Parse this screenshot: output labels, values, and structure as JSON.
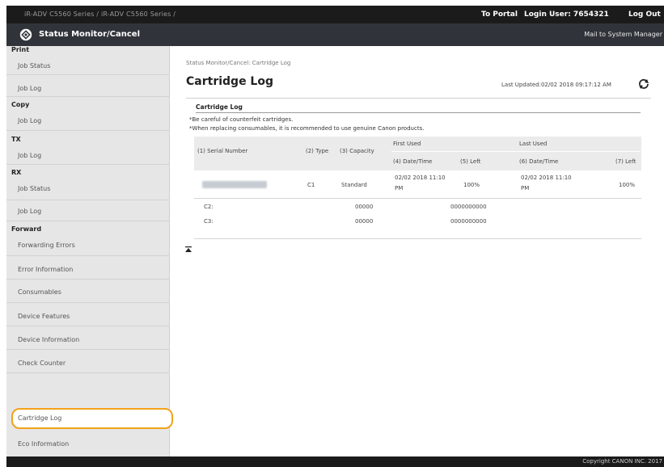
{
  "topbar": {
    "product": "iR-ADV C5560 Series / iR-ADV C5560 Series /",
    "portal": "To Portal",
    "login": "Login User:  7654321",
    "logout": "Log Out"
  },
  "header": {
    "title": "Status Monitor/Cancel",
    "mail": "Mail to System Manager"
  },
  "sidebar": {
    "print": "Print",
    "print_items": [
      "Job Status",
      "Job Log"
    ],
    "copy": "Copy",
    "copy_items": [
      "Job Log"
    ],
    "tx": "TX",
    "tx_items": [
      "Job Log"
    ],
    "rx": "RX",
    "rx_items": [
      "Job Status",
      "Job Log"
    ],
    "forward": "Forward",
    "forward_items": [
      "Forwarding Errors",
      "Error Information",
      "Consumables",
      "Device Features",
      "Device Information",
      "Check Counter",
      "Cartridge Log",
      "Eco Information"
    ]
  },
  "content": {
    "breadcrumb": "Status Monitor/Cancel: Cartridge Log",
    "title": "Cartridge Log",
    "last_updated": "Last Updated:02/02 2018 09:17:12 AM",
    "section_title": "Cartridge Log",
    "note1": "*Be careful of counterfeit cartridges.",
    "note2": "*When replacing consumables, it is recommended to use genuine Canon products.",
    "headers": {
      "serial": "(1) Serial Number",
      "type": "(2) Type",
      "capacity": "(3) Capacity",
      "first_used": "First Used",
      "last_used": "Last Used",
      "date_first": "(4) Date/Time",
      "left_first": "(5) Left",
      "date_last": "(6) Date/Time",
      "left_last": "(7) Left"
    },
    "row1": {
      "type": "C1",
      "capacity": "Standard",
      "first_date_l1": "02/02 2018 11:10",
      "first_date_l2": "PM",
      "first_left": "100%",
      "last_date_l1": "02/02 2018 11:10",
      "last_date_l2": "PM",
      "last_left": "100%"
    },
    "row2": {
      "label": "C2:",
      "code": "00000",
      "value": "0000000000"
    },
    "row3": {
      "label": "C3:",
      "code": "00000",
      "value": "0000000000"
    }
  },
  "footer": {
    "copyright": "Copyright CANON INC. 2017"
  },
  "colors": {
    "highlight": "#f2a21b",
    "header_bg": "#30343a",
    "top_bg": "#1b1b1b",
    "sidebar_bg": "#e6e6e6"
  }
}
